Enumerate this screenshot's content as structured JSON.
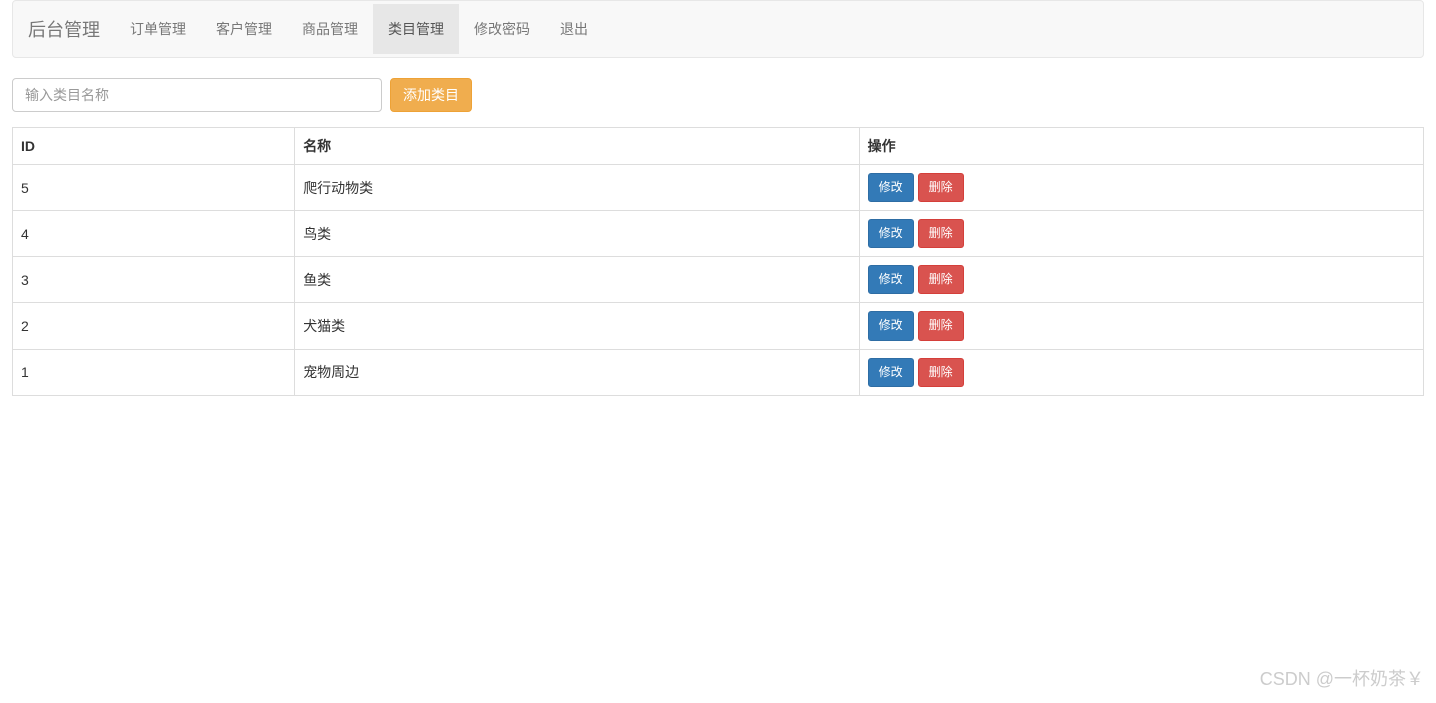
{
  "navbar": {
    "brand": "后台管理",
    "items": [
      {
        "label": "订单管理",
        "active": false
      },
      {
        "label": "客户管理",
        "active": false
      },
      {
        "label": "商品管理",
        "active": false
      },
      {
        "label": "类目管理",
        "active": true
      },
      {
        "label": "修改密码",
        "active": false
      },
      {
        "label": "退出",
        "active": false
      }
    ]
  },
  "form": {
    "input_placeholder": "输入类目名称",
    "input_value": "",
    "add_button": "添加类目"
  },
  "table": {
    "headers": {
      "id": "ID",
      "name": "名称",
      "actions": "操作"
    },
    "action_labels": {
      "edit": "修改",
      "delete": "删除"
    },
    "rows": [
      {
        "id": "5",
        "name": "爬行动物类"
      },
      {
        "id": "4",
        "name": "鸟类"
      },
      {
        "id": "3",
        "name": "鱼类"
      },
      {
        "id": "2",
        "name": "犬猫类"
      },
      {
        "id": "1",
        "name": "宠物周边"
      }
    ]
  },
  "watermark": "CSDN @一杯奶茶￥"
}
